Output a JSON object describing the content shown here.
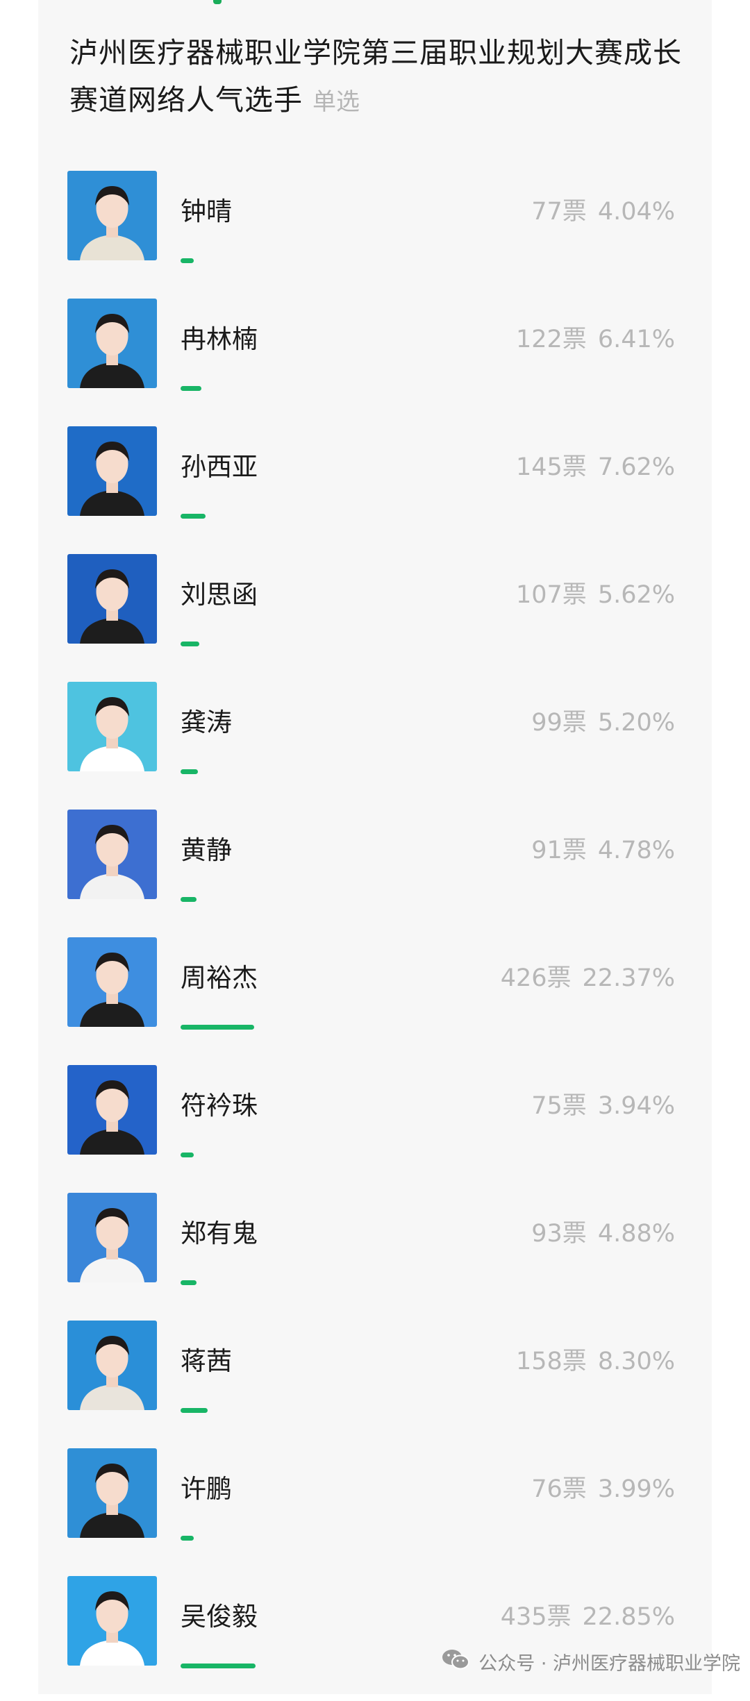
{
  "poll": {
    "title": "泸州医疗器械职业学院第三届职业规划大赛成长赛道网络人气选手",
    "type_tag": "单选"
  },
  "colors": {
    "bar": "#18b566",
    "stat_text": "#b7b7b7"
  },
  "options": [
    {
      "name": "钟晴",
      "votes": "77票",
      "percent": "4.04%",
      "share": 4.04,
      "bg": "#2f8fd6",
      "top": "#e8e2d5"
    },
    {
      "name": "冉林楠",
      "votes": "122票",
      "percent": "6.41%",
      "share": 6.41,
      "bg": "#2f8fd6",
      "top": "#1d1d1d"
    },
    {
      "name": "孙西亚",
      "votes": "145票",
      "percent": "7.62%",
      "share": 7.62,
      "bg": "#1f6cc7",
      "top": "#1d1d1d"
    },
    {
      "name": "刘思函",
      "votes": "107票",
      "percent": "5.62%",
      "share": 5.62,
      "bg": "#1f5fbf",
      "top": "#1d1d1d"
    },
    {
      "name": "龚涛",
      "votes": "99票",
      "percent": "5.20%",
      "share": 5.2,
      "bg": "#4ec3e0",
      "top": "#ffffff"
    },
    {
      "name": "黄静",
      "votes": "91票",
      "percent": "4.78%",
      "share": 4.78,
      "bg": "#3d6fd1",
      "top": "#f2f2f2"
    },
    {
      "name": "周裕杰",
      "votes": "426票",
      "percent": "22.37%",
      "share": 22.37,
      "bg": "#3e8ee0",
      "top": "#1d1d1d"
    },
    {
      "name": "符衿珠",
      "votes": "75票",
      "percent": "3.94%",
      "share": 3.94,
      "bg": "#2463c9",
      "top": "#1d1d1d"
    },
    {
      "name": "郑有鬼",
      "votes": "93票",
      "percent": "4.88%",
      "share": 4.88,
      "bg": "#3a86d9",
      "top": "#f5f5f5"
    },
    {
      "name": "蒋茜",
      "votes": "158票",
      "percent": "8.30%",
      "share": 8.3,
      "bg": "#2a8fd8",
      "top": "#e9e4dc"
    },
    {
      "name": "许鹏",
      "votes": "76票",
      "percent": "3.99%",
      "share": 3.99,
      "bg": "#2f8fd6",
      "top": "#1d1d1d"
    },
    {
      "name": "吴俊毅",
      "votes": "435票",
      "percent": "22.85%",
      "share": 22.85,
      "bg": "#2fa3e6",
      "top": "#ffffff"
    }
  ],
  "footer": {
    "text": "公众号 · 泸州医疗器械职业学院",
    "icon": "wechat-icon"
  }
}
